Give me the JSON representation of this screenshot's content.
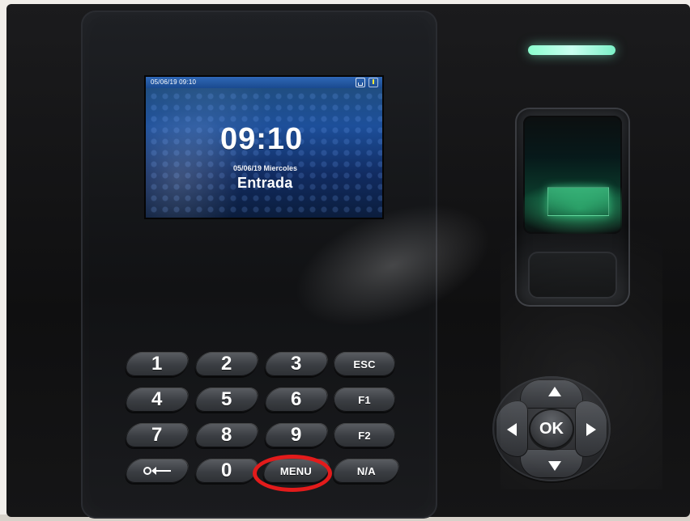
{
  "screen": {
    "status_datetime": "05/06/19 09:10",
    "time": "09:10",
    "date_line": "05/06/19 Miercoles",
    "mode": "Entrada",
    "icons": [
      "network-icon",
      "alert-icon"
    ]
  },
  "keypad": {
    "keys": {
      "k1": "1",
      "k2": "2",
      "k3": "3",
      "esc": "ESC",
      "k4": "4",
      "k5": "5",
      "k6": "6",
      "f1": "F1",
      "k7": "7",
      "k8": "8",
      "k9": "9",
      "f2": "F2",
      "k0": "0",
      "menu": "MENU",
      "na": "N/A"
    }
  },
  "dpad": {
    "ok": "OK"
  },
  "colors": {
    "highlight": "#e31b1b",
    "led": "#8bffcf",
    "scanner_glow": "#46ffa0",
    "screen_blue": "#1d4f9a"
  }
}
